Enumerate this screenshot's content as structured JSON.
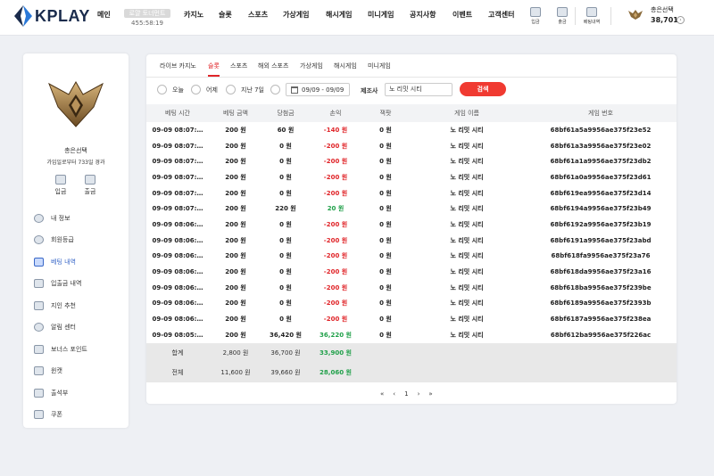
{
  "header": {
    "brand": "KPLAY",
    "nav": [
      "메인",
      "카지노",
      "슬롯",
      "스포츠",
      "가상게임",
      "해시게임",
      "미니게임",
      "공지사항",
      "이벤트",
      "고객센터"
    ],
    "nav_badge_top": "로얄 토너먼트",
    "nav_badge_bottom": "455:58:19",
    "quick_icons": [
      {
        "label": "입금",
        "icon": "deposit-icon"
      },
      {
        "label": "출금",
        "icon": "withdraw-icon"
      },
      {
        "label": "베팅내역",
        "icon": "bet-history-icon"
      }
    ],
    "user": {
      "name": "총은선택",
      "money": "38,701"
    }
  },
  "sidebar": {
    "profile_name": "총은선택",
    "profile_sub": "가입일로부터 733일 경과",
    "quick": [
      {
        "label": "입금"
      },
      {
        "label": "출금"
      }
    ],
    "menu": [
      {
        "label": "내 정보",
        "icon": "user-icon"
      },
      {
        "label": "회원등급",
        "icon": "rank-icon"
      },
      {
        "label": "베팅 내역",
        "icon": "bet-history-icon"
      },
      {
        "label": "입출금 내역",
        "icon": "transaction-icon"
      },
      {
        "label": "지인 추천",
        "icon": "referral-icon"
      },
      {
        "label": "알림 센터",
        "icon": "notification-icon"
      },
      {
        "label": "보너스 포인트",
        "icon": "bonus-icon"
      },
      {
        "label": "윈캣",
        "icon": "wincat-icon"
      },
      {
        "label": "출석부",
        "icon": "attendance-icon"
      },
      {
        "label": "쿠폰",
        "icon": "coupon-icon"
      }
    ],
    "active_menu": "베팅 내역"
  },
  "main": {
    "tabs": [
      "라이브 카지노",
      "슬롯",
      "스포츠",
      "해외 스포츠",
      "가상게임",
      "해시게임",
      "미니게임"
    ],
    "active_tab": "슬롯",
    "filters": {
      "radios": [
        "오늘",
        "어제",
        "지난 7일"
      ],
      "date_range": "09/09 - 09/09",
      "vendor_label": "제조사",
      "vendor_value": "노 리밋 시티",
      "search_label": "검색"
    },
    "columns": [
      "베팅 시간",
      "베팅 금액",
      "당첨금",
      "손익",
      "잭팟",
      "게임 이름",
      "게임 번호"
    ],
    "rows": [
      [
        "09-09 08:07:…",
        "200 원",
        "60 원",
        "-140 원",
        "0 원",
        "노 리밋 시티",
        "68bf61a5a9956ae375f23e52"
      ],
      [
        "09-09 08:07:…",
        "200 원",
        "0 원",
        "-200 원",
        "0 원",
        "노 리밋 시티",
        "68bf61a3a9956ae375f23e02"
      ],
      [
        "09-09 08:07:…",
        "200 원",
        "0 원",
        "-200 원",
        "0 원",
        "노 리밋 시티",
        "68bf61a1a9956ae375f23db2"
      ],
      [
        "09-09 08:07:…",
        "200 원",
        "0 원",
        "-200 원",
        "0 원",
        "노 리밋 시티",
        "68bf61a0a9956ae375f23d61"
      ],
      [
        "09-09 08:07:…",
        "200 원",
        "0 원",
        "-200 원",
        "0 원",
        "노 리밋 시티",
        "68bf619ea9956ae375f23d14"
      ],
      [
        "09-09 08:07:…",
        "200 원",
        "220 원",
        "20 원",
        "0 원",
        "노 리밋 시티",
        "68bf6194a9956ae375f23b49"
      ],
      [
        "09-09 08:06:…",
        "200 원",
        "0 원",
        "-200 원",
        "0 원",
        "노 리밋 시티",
        "68bf6192a9956ae375f23b19"
      ],
      [
        "09-09 08:06:…",
        "200 원",
        "0 원",
        "-200 원",
        "0 원",
        "노 리밋 시티",
        "68bf6191a9956ae375f23abd"
      ],
      [
        "09-09 08:06:…",
        "200 원",
        "0 원",
        "-200 원",
        "0 원",
        "노 리밋 시티",
        "68bf618fa9956ae375f23a76"
      ],
      [
        "09-09 08:06:…",
        "200 원",
        "0 원",
        "-200 원",
        "0 원",
        "노 리밋 시티",
        "68bf618da9956ae375f23a16"
      ],
      [
        "09-09 08:06:…",
        "200 원",
        "0 원",
        "-200 원",
        "0 원",
        "노 리밋 시티",
        "68bf618ba9956ae375f239be"
      ],
      [
        "09-09 08:06:…",
        "200 원",
        "0 원",
        "-200 원",
        "0 원",
        "노 리밋 시티",
        "68bf6189a9956ae375f2393b"
      ],
      [
        "09-09 08:06:…",
        "200 원",
        "0 원",
        "-200 원",
        "0 원",
        "노 리밋 시티",
        "68bf6187a9956ae375f238ea"
      ],
      [
        "09-09 08:05:…",
        "200 원",
        "36,420 원",
        "36,220 원",
        "0 원",
        "노 리밋 시티",
        "68bf612ba9956ae375f226ac"
      ]
    ],
    "summary": [
      {
        "label": "합계",
        "bet": "2,800 원",
        "win": "36,700 원",
        "profit": "33,900 원"
      },
      {
        "label": "전체",
        "bet": "11,600 원",
        "win": "39,660 원",
        "profit": "28,060 원"
      }
    ],
    "pagination": {
      "first": "«",
      "prev": "‹",
      "page": "1",
      "next": "›",
      "last": "»"
    }
  },
  "colors": {
    "accent_red": "#f03a31",
    "profit_green": "#21a04a",
    "active_blue": "#3a68c8"
  }
}
